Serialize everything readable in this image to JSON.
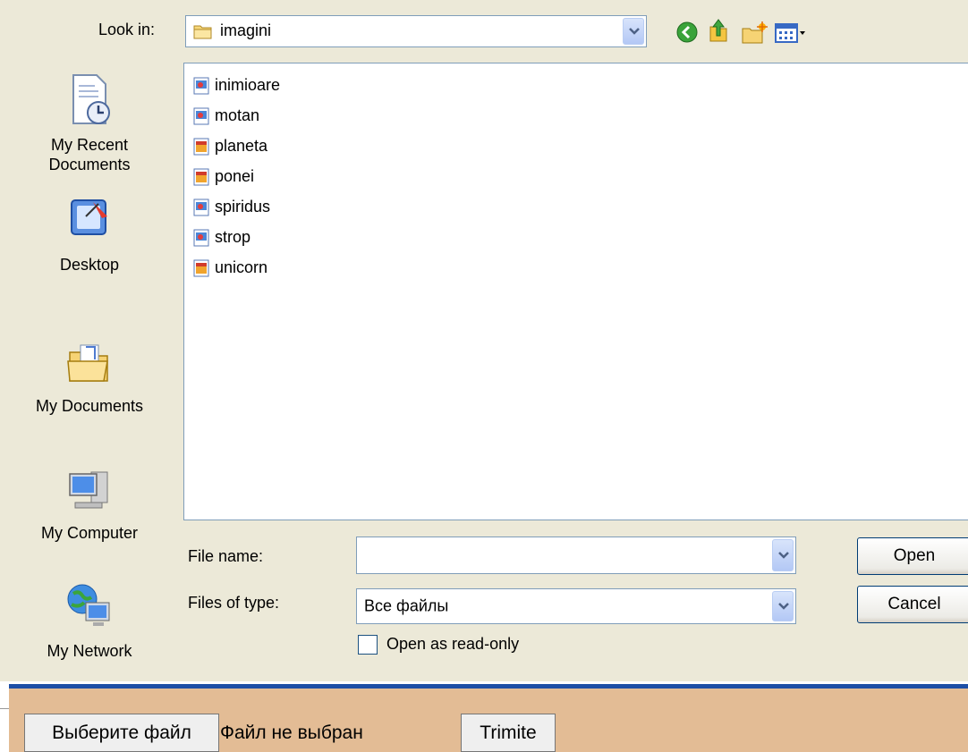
{
  "dialog": {
    "look_in_label": "Look in:",
    "look_in_value": "imagini",
    "toolbar": [
      "back-icon",
      "up-folder-icon",
      "new-folder-icon",
      "views-menu-icon"
    ],
    "places": [
      {
        "label": "My Recent\nDocuments",
        "icon": "recent-documents-icon"
      },
      {
        "label": "Desktop",
        "icon": "desktop-icon"
      },
      {
        "label": "My Documents",
        "icon": "my-documents-icon"
      },
      {
        "label": "My Computer",
        "icon": "my-computer-icon"
      },
      {
        "label": "My Network",
        "icon": "my-network-icon"
      }
    ],
    "files": [
      {
        "name": "inimioare",
        "icon": "image-file-icon"
      },
      {
        "name": "motan",
        "icon": "image-file-icon"
      },
      {
        "name": "planeta",
        "icon": "bitmap-file-icon"
      },
      {
        "name": "ponei",
        "icon": "bitmap-file-icon"
      },
      {
        "name": "spiridus",
        "icon": "image-file-icon"
      },
      {
        "name": "strop",
        "icon": "image-file-icon"
      },
      {
        "name": "unicorn",
        "icon": "bitmap-file-icon"
      }
    ],
    "file_name_label": "File name:",
    "file_name_value": "",
    "files_of_type_label": "Files of type:",
    "files_of_type_value": "Все файлы",
    "open_button": "Open",
    "cancel_button": "Cancel",
    "read_only_label": "Open as read-only"
  },
  "web_form": {
    "choose_file_button": "Выберите файл",
    "no_file_text": "Файл не выбран",
    "submit_button": "Trimite"
  },
  "colors": {
    "dialog_bg": "#ece9d8",
    "accent_blue": "#1d4fa5",
    "page_bg": "#e3bc95"
  }
}
